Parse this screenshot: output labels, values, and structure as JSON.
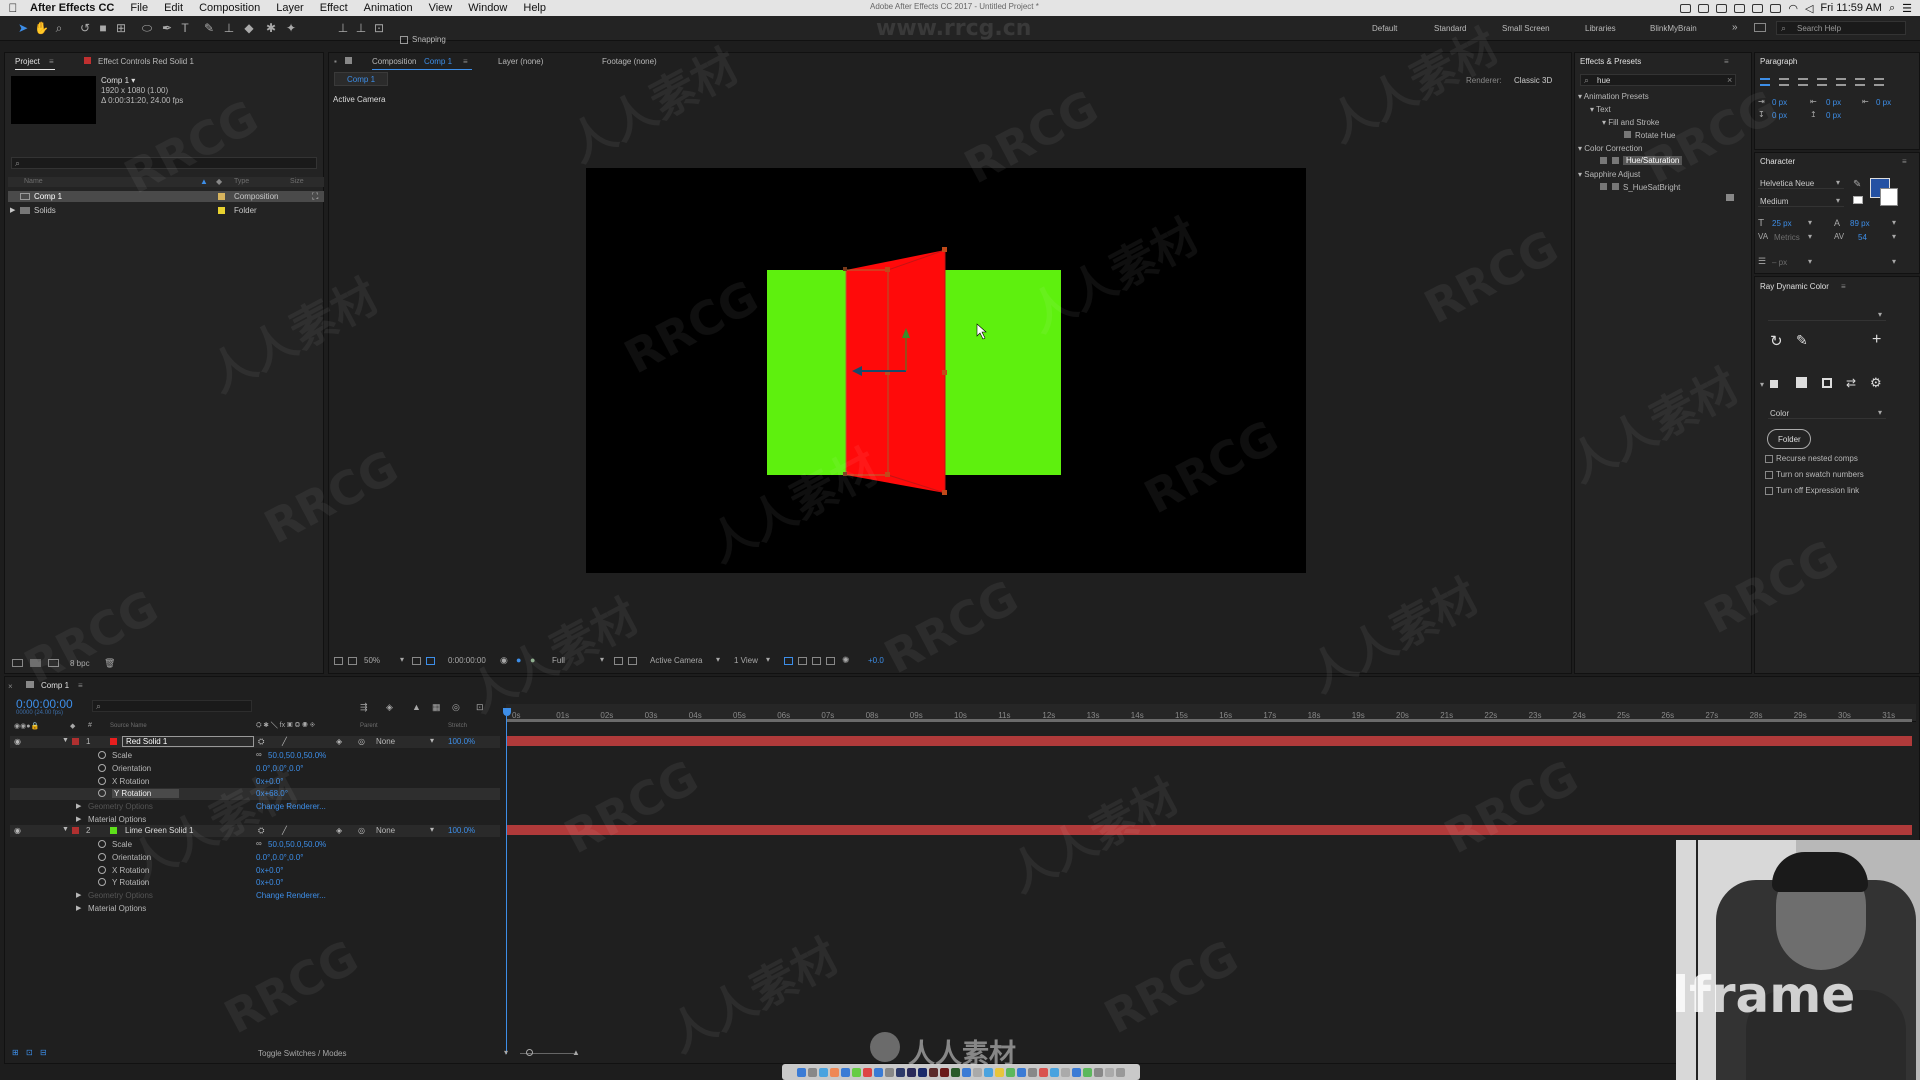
{
  "menubar": {
    "app": "After Effects CC",
    "items": [
      "File",
      "Edit",
      "Composition",
      "Layer",
      "Effect",
      "Animation",
      "View",
      "Window",
      "Help"
    ],
    "window_title": "Adobe After Effects CC 2017 - Untitled Project *",
    "clock": "Fri 11:59 AM"
  },
  "toolbar": {
    "snapping_label": "Snapping",
    "workspaces": [
      "Default",
      "Standard",
      "Small Screen",
      "Libraries",
      "BlinkMyBrain"
    ],
    "search_placeholder": "Search Help"
  },
  "project": {
    "tab_project": "Project",
    "tab_effect_controls": "Effect Controls Red Solid 1",
    "comp_name": "Comp 1 ▾",
    "comp_size": "1920 x 1080 (1.00)",
    "comp_duration": "Δ 0:00:31:20, 24.00 fps",
    "col_name": "Name",
    "col_type": "Type",
    "col_size": "Size",
    "items": [
      {
        "name": "Comp 1",
        "type": "Composition",
        "color": "#d7b45e"
      },
      {
        "name": "Solids",
        "type": "Folder",
        "color": "#e8d22f"
      }
    ],
    "bpc": "8 bpc"
  },
  "viewer": {
    "tab_composition": "Composition",
    "tab_comp_name": "Comp 1",
    "tab_layer": "Layer (none)",
    "tab_footage": "Footage (none)",
    "subtab": "Comp 1",
    "renderer_label": "Renderer:",
    "renderer_value": "Classic 3D",
    "active_camera": "Active Camera",
    "zoom": "50%",
    "timecode": "0:00:00:00",
    "resolution": "Full",
    "camera": "Active Camera",
    "views": "1 View",
    "exposure": "+0.0"
  },
  "effects": {
    "title": "Effects & Presets",
    "search_value": "hue",
    "tree": [
      {
        "label": "▾ Animation Presets",
        "level": 0
      },
      {
        "label": "▾ Text",
        "level": 1
      },
      {
        "label": "▾ Fill and Stroke",
        "level": 2
      },
      {
        "label": "Rotate Hue",
        "level": 3
      },
      {
        "label": "▾ Color Correction",
        "level": 0
      },
      {
        "label": "Hue/Saturation",
        "level": 2,
        "selected": true
      },
      {
        "label": "▾ Sapphire Adjust",
        "level": 0
      },
      {
        "label": "S_HueSatBright",
        "level": 2
      }
    ]
  },
  "paragraph": {
    "title": "Paragraph",
    "values": [
      "0 px",
      "0 px",
      "0 px",
      "0 px",
      "0 px"
    ]
  },
  "character": {
    "title": "Character",
    "font": "Helvetica Neue",
    "style": "Medium",
    "size": "25 px",
    "leading": "89 px",
    "kerning": "Metrics",
    "tracking": "54",
    "stroke": "– px"
  },
  "ray": {
    "title": "Ray Dynamic Color",
    "dropdown": "Color",
    "folder_button": "Folder",
    "options": [
      "Recurse nested comps",
      "Turn on swatch numbers",
      "Turn off Expression link"
    ]
  },
  "timeline": {
    "tab": "Comp 1",
    "timecode": "0:00:00:00",
    "fps_sub": "00000 (24.00 fps)",
    "headers": {
      "source": "Source Name",
      "parent": "Parent",
      "stretch": "Stretch"
    },
    "ruler": [
      "0s",
      "01s",
      "02s",
      "03s",
      "04s",
      "05s",
      "06s",
      "07s",
      "08s",
      "09s",
      "10s",
      "11s",
      "12s",
      "13s",
      "14s",
      "15s",
      "16s",
      "17s",
      "18s",
      "19s",
      "20s",
      "21s",
      "22s",
      "23s",
      "24s",
      "25s",
      "26s",
      "27s",
      "28s",
      "29s",
      "30s",
      "31s"
    ],
    "layers": [
      {
        "num": "1",
        "name": "Red Solid 1",
        "color": "#e81e1e",
        "parent": "None",
        "stretch": "100.0%",
        "props": [
          {
            "name": "Scale",
            "value": "50.0,50.0,50.0%"
          },
          {
            "name": "Orientation",
            "value": "0.0°,0.0°,0.0°"
          },
          {
            "name": "X Rotation",
            "value": "0x+0.0°"
          },
          {
            "name": "Y Rotation",
            "value": "0x+68.0°"
          },
          {
            "name": "Geometry Options",
            "value": "Change Renderer..."
          },
          {
            "name": "Material Options",
            "value": ""
          }
        ]
      },
      {
        "num": "2",
        "name": "Lime Green Solid 1",
        "color": "#5ee01a",
        "parent": "None",
        "stretch": "100.0%",
        "props": [
          {
            "name": "Scale",
            "value": "50.0,50.0,50.0%"
          },
          {
            "name": "Orientation",
            "value": "0.0°,0.0°,0.0°"
          },
          {
            "name": "X Rotation",
            "value": "0x+0.0°"
          },
          {
            "name": "Y Rotation",
            "value": "0x+0.0°"
          },
          {
            "name": "Geometry Options",
            "value": "Change Renderer..."
          },
          {
            "name": "Material Options",
            "value": ""
          }
        ]
      }
    ],
    "toggle_label": "Toggle Switches / Modes"
  },
  "overlays": {
    "holdframe": "Holdframe",
    "site": "人人素材",
    "watermark_a": "RRCG",
    "watermark_b": "人人素材",
    "url": "www.rrcg.cn"
  },
  "colors": {
    "accent": "#3d8ee8",
    "comp_green": "#5ef00e",
    "comp_red": "#ff0a0a",
    "layer_bar": "#b03a3a"
  }
}
